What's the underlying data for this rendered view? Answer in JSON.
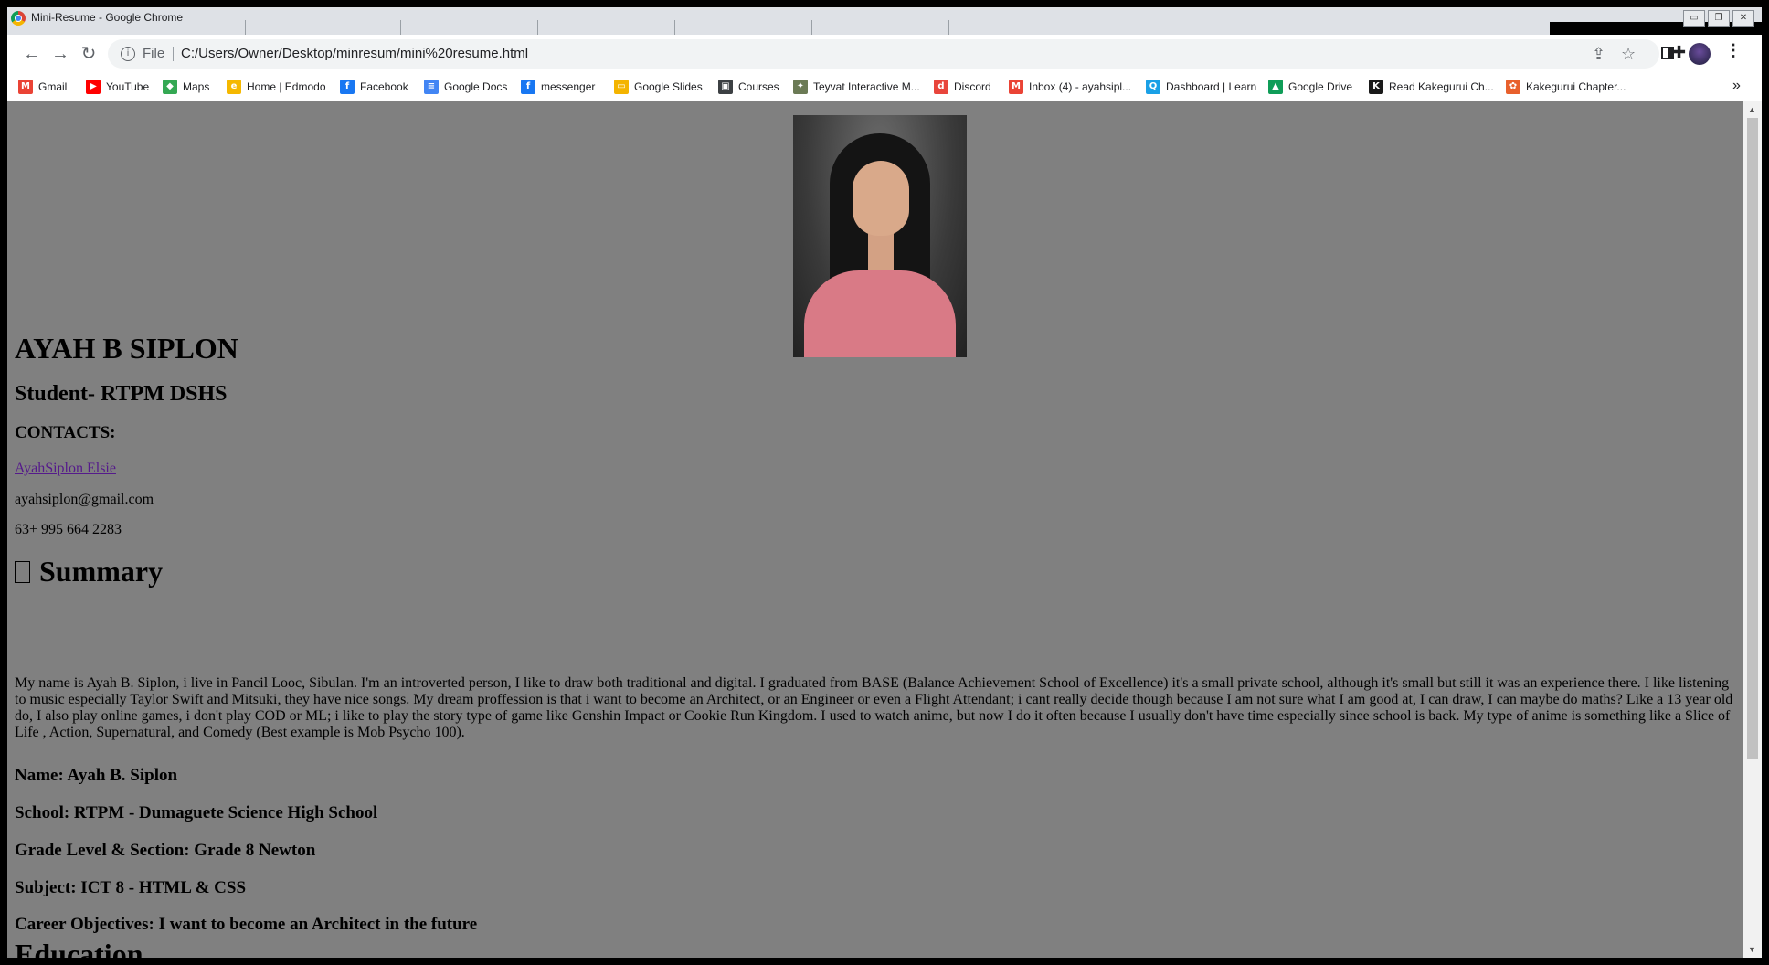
{
  "window": {
    "title": "Mini-Resume - Google Chrome",
    "controls": {
      "minimize": "▭",
      "restore": "❐",
      "close": "✕"
    }
  },
  "toolbar": {
    "back": "←",
    "forward": "→",
    "reload": "↻",
    "scheme": "File",
    "url": "C:/Users/Owner/Desktop/minresum/mini%20resume.html",
    "icons": [
      "share-icon",
      "star-icon",
      "extensions-icon",
      "side-panel-icon",
      "profile-avatar",
      "menu-icon"
    ]
  },
  "bookmarks": [
    {
      "label": "Gmail",
      "icon": "gmail-icon",
      "color": "#ea4335",
      "glyph": "M"
    },
    {
      "label": "YouTube",
      "icon": "youtube-icon",
      "color": "#ff0000",
      "glyph": "▶"
    },
    {
      "label": "Maps",
      "icon": "maps-icon",
      "color": "#34a853",
      "glyph": "◆"
    },
    {
      "label": "Home | Edmodo",
      "icon": "edmodo-icon",
      "color": "#f5b800",
      "glyph": "e"
    },
    {
      "label": "Facebook",
      "icon": "facebook-icon",
      "color": "#1877f2",
      "glyph": "f"
    },
    {
      "label": "Google Docs",
      "icon": "docs-icon",
      "color": "#4285f4",
      "glyph": "≡"
    },
    {
      "label": "messenger",
      "icon": "facebook-icon",
      "color": "#1877f2",
      "glyph": "f"
    },
    {
      "label": "Google Slides",
      "icon": "slides-icon",
      "color": "#f4b400",
      "glyph": "▭"
    },
    {
      "label": "Courses",
      "icon": "courses-icon",
      "color": "#3c4043",
      "glyph": "▣"
    },
    {
      "label": "Teyvat Interactive M...",
      "icon": "teyvat-icon",
      "color": "#6b7a55",
      "glyph": "✦"
    },
    {
      "label": "Discord",
      "icon": "discord-icon",
      "color": "#e8453c",
      "glyph": "d"
    },
    {
      "label": "Inbox (4) - ayahsipl...",
      "icon": "gmail-icon",
      "color": "#ea4335",
      "glyph": "M"
    },
    {
      "label": "Dashboard | Learn",
      "icon": "learn-icon",
      "color": "#1aa0e6",
      "glyph": "Q"
    },
    {
      "label": "Google Drive",
      "icon": "drive-icon",
      "color": "#0f9d58",
      "glyph": "▲"
    },
    {
      "label": "Read Kakegurui Ch...",
      "icon": "manga-icon",
      "color": "#1a1a1a",
      "glyph": "K"
    },
    {
      "label": "Kakegurui Chapter...",
      "icon": "kakegurui-icon",
      "color": "#e8602c",
      "glyph": "✿"
    }
  ],
  "bookmarks_more": "»",
  "page": {
    "photo_name": "profile-photo",
    "name": "AYAH B SIPLON",
    "role": "Student- RTPM DSHS",
    "contacts_heading": "CONTACTS:",
    "link_text": "AyahSiplon Elsie",
    "email": "ayahsiplon@gmail.com",
    "phone": "63+ 995 664 2283",
    "summary_heading": "Summary",
    "summary_text": "My name is Ayah B. Siplon, i live in Pancil Looc, Sibulan. I'm an introverted person, I like to draw both traditional and digital. I graduated from BASE (Balance Achievement School of Excellence) it's a small private school, although it's small but still it was an experience there. I like listening to music especially Taylor Swift and Mitsuki, they have nice songs. My dream proffession is that i want to become an Architect, or an Engineer or even a Flight Attendant; i cant really decide though because I am not sure what I am good at, I can draw, I can maybe do maths? Like a 13 year old do, I also play online games, i don't play COD or ML; i like to play the story type of game like Genshin Impact or Cookie Run Kingdom. I used to watch anime, but now I do it often because I usually don't have time especially since school is back. My type of anime is something like a Slice of Life , Action, Supernatural, and Comedy (Best example is Mob Psycho 100).",
    "info": [
      "Name: Ayah B. Siplon",
      "School: RTPM - Dumaguete Science High School",
      "Grade Level & Section: Grade 8 Newton",
      "Subject: ICT 8 - HTML & CSS",
      "Career Objectives: I want to become an Architect in the future"
    ],
    "education_heading": "Education"
  },
  "colors": {
    "page_bg": "#808080",
    "chrome_frame": "#dee1e6",
    "link": "#551a8b"
  }
}
